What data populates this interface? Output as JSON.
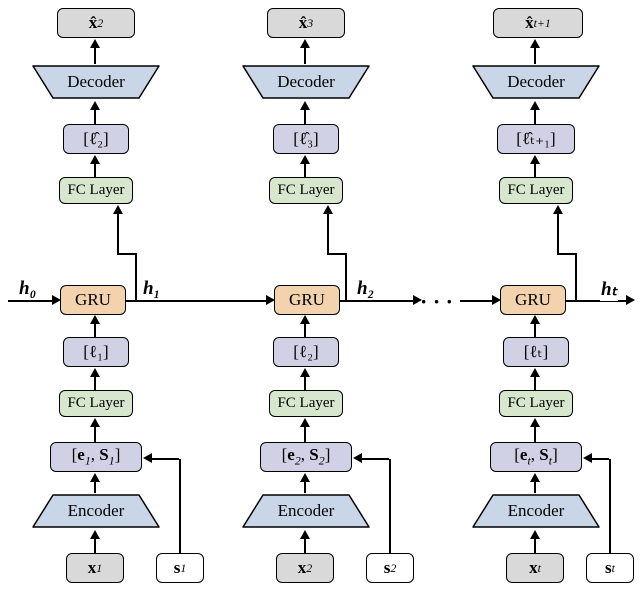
{
  "outputs": {
    "c1": "x̂₂",
    "c2": "x̂₃",
    "c3": "x̂ₜ₊₁"
  },
  "decoder": "Decoder",
  "latent_hat": {
    "c1": "[ℓ̂₂]",
    "c2": "[ℓ̂₃]",
    "c3": "[ℓ̂ₜ₊₁]"
  },
  "fc": "FC Layer",
  "h": {
    "in": "h₀",
    "c1": "h₁",
    "c2": "h₂",
    "out": "hₜ"
  },
  "gru": "GRU",
  "latent": {
    "c1": "[ℓ₁]",
    "c2": "[ℓ₂]",
    "c3": "[ℓₜ]"
  },
  "embed": {
    "c1": "[e₁, S₁]",
    "c2": "[e₂, S₂]",
    "c3": "[eₜ, Sₜ]"
  },
  "encoder": "Encoder",
  "x": {
    "c1": "x₁",
    "c2": "x₂",
    "c3": "xₜ"
  },
  "s": {
    "c1": "s₁",
    "c2": "s₂",
    "c3": "sₜ"
  },
  "dots": "· · ·"
}
